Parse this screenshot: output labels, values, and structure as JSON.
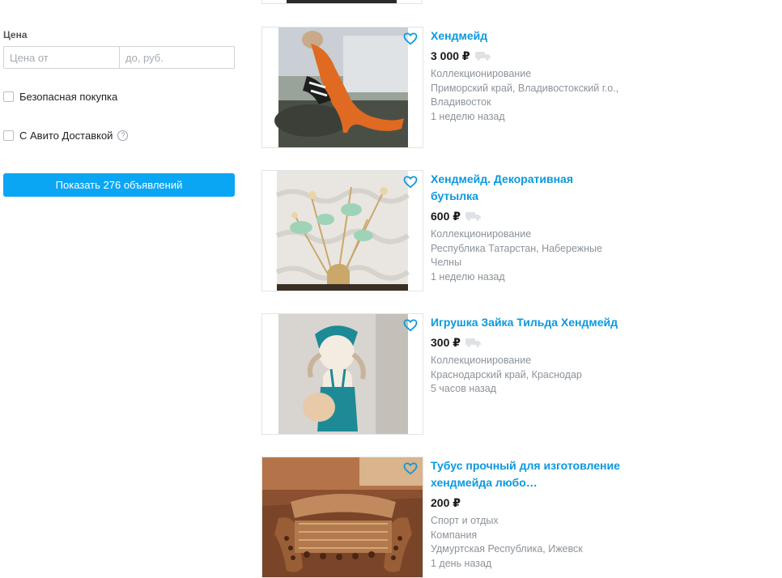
{
  "sidebar": {
    "price_label": "Цена",
    "price_from_placeholder": "Цена от",
    "price_to_placeholder": "до, руб.",
    "safe_purchase_label": "Безопасная покупка",
    "avito_delivery_label": "С Авито Доставкой",
    "help_glyph": "?",
    "show_button_label": "Показать 276 объявлений"
  },
  "listings": [
    {
      "title": "Хендмейд",
      "price": "3 000 ₽",
      "has_delivery": true,
      "meta": [
        "Коллекционирование",
        "Приморский край, Владивостокский г.о.,",
        "Владивосток",
        "1 неделю назад"
      ]
    },
    {
      "title": "Хендмейд. Декоративная бутылка",
      "price": "600 ₽",
      "has_delivery": true,
      "meta": [
        "Коллекционирование",
        "Республика Татарстан, Набережные",
        "Челны",
        "1 неделю назад"
      ]
    },
    {
      "title": "Игрушка Зайка Тильда Хендмейд",
      "price": "300 ₽",
      "has_delivery": true,
      "meta": [
        "Коллекционирование",
        "Краснодарский край, Краснодар",
        "5 часов назад"
      ]
    },
    {
      "title": "Тубус прочный для изготовление хендмейда любо…",
      "price": "200 ₽",
      "has_delivery": false,
      "meta": [
        "Спорт и отдых",
        "Компания",
        "Удмуртская Республика, Ижевск",
        "1 день назад"
      ]
    }
  ],
  "colors": {
    "link": "#0a99de",
    "button": "#0ba6f3",
    "meta_text": "#8c939a"
  },
  "icons": {
    "favorite": "heart-outline-icon",
    "delivery": "delivery-truck-icon",
    "help": "question-circle-icon"
  }
}
